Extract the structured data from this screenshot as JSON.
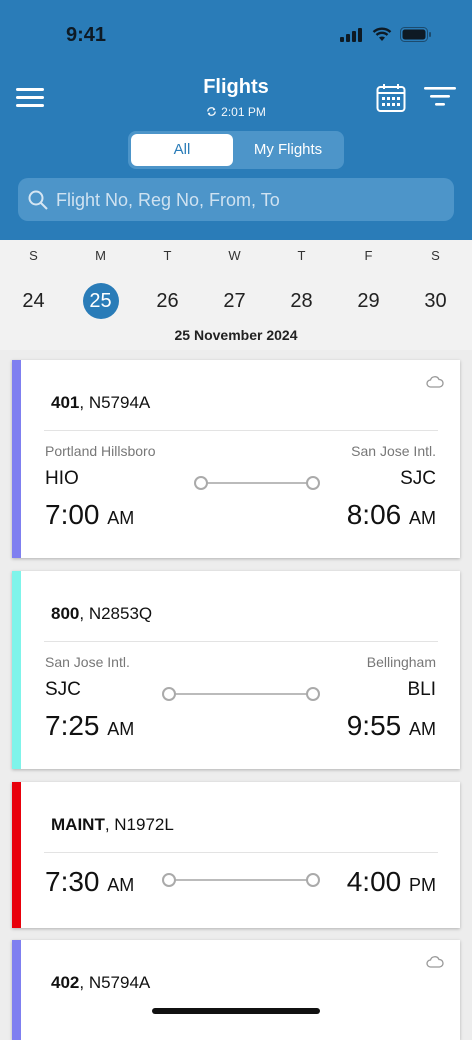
{
  "status": {
    "time": "9:41"
  },
  "header": {
    "title": "Flights",
    "sync_time": "2:01 PM"
  },
  "segments": {
    "all": "All",
    "mine": "My Flights"
  },
  "search": {
    "placeholder": "Flight No, Reg No, From, To"
  },
  "week": {
    "days": [
      {
        "dow": "S",
        "num": "24",
        "selected": false
      },
      {
        "dow": "M",
        "num": "25",
        "selected": true
      },
      {
        "dow": "T",
        "num": "26",
        "selected": false
      },
      {
        "dow": "W",
        "num": "27",
        "selected": false
      },
      {
        "dow": "T",
        "num": "28",
        "selected": false
      },
      {
        "dow": "F",
        "num": "29",
        "selected": false
      },
      {
        "dow": "S",
        "num": "30",
        "selected": false
      }
    ],
    "date_label": "25 November 2024"
  },
  "flights": [
    {
      "number": "401",
      "reg": "N5794A",
      "from_name": "Portland Hillsboro",
      "from_code": "HIO",
      "to_name": "San Jose Intl.",
      "to_code": "SJC",
      "dep_time": "7:00",
      "dep_ampm": "AM",
      "arr_time": "8:06",
      "arr_ampm": "AM",
      "accent": "#7f7ff0"
    },
    {
      "number": "800",
      "reg": "N2853Q",
      "from_name": "San Jose Intl.",
      "from_code": "SJC",
      "to_name": "Bellingham",
      "to_code": "BLI",
      "dep_time": "7:25",
      "dep_ampm": "AM",
      "arr_time": "9:55",
      "arr_ampm": "AM",
      "accent": "#7ff4ea"
    },
    {
      "number": "MAINT",
      "reg": "N1972L",
      "dep_time": "7:30",
      "dep_ampm": "AM",
      "arr_time": "4:00",
      "arr_ampm": "PM",
      "accent": "#e8000b"
    },
    {
      "number": "402",
      "reg": "N5794A",
      "accent": "#7f7ff0"
    }
  ]
}
